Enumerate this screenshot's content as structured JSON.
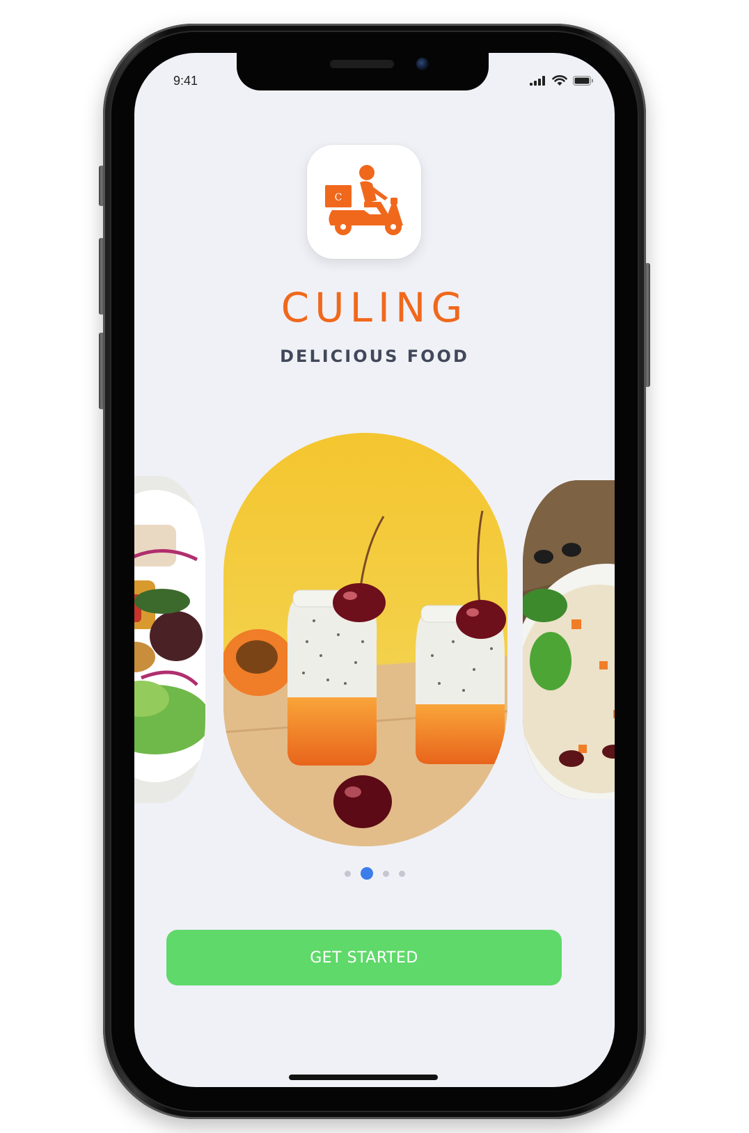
{
  "status_bar": {
    "time": "9:41"
  },
  "app": {
    "logo_icon": "delivery-scooter-icon",
    "logo_letter": "C",
    "brand_name": "CULING",
    "tagline": "DELICIOUS FOOD"
  },
  "carousel": {
    "slides": [
      {
        "image": "salad"
      },
      {
        "image": "chia-pudding-with-cherries"
      },
      {
        "image": "rice-dish"
      }
    ],
    "page_count": 4,
    "active_index": 1
  },
  "cta": {
    "label": "GET STARTED"
  },
  "colors": {
    "brand": "#f0681c",
    "tagline": "#414859",
    "cta": "#5fd96a",
    "active_dot": "#3b7dea",
    "screen_bg": "#f0f1f6"
  }
}
